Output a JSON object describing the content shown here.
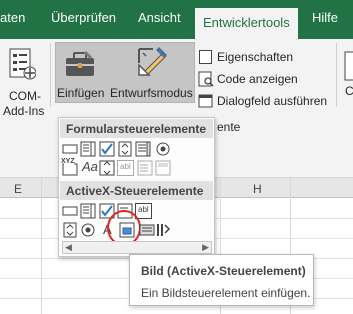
{
  "tabs": [
    {
      "label": "aten"
    },
    {
      "label": "Überprüfen"
    },
    {
      "label": "Ansicht"
    },
    {
      "label": "Entwicklertools"
    },
    {
      "label": "Hilfe"
    }
  ],
  "ribbon": {
    "com_addins": {
      "line1": "COM-",
      "line2": "Add-Ins"
    },
    "insert_label": "Einfügen",
    "design_mode_label": "Entwurfsmodus",
    "properties_label": "Eigenschaften",
    "view_code_label": "Code anzeigen",
    "run_dialog_label": "Dialogfeld ausführen",
    "group_label_partial": "ente",
    "right_partial_label": "C"
  },
  "dropdown": {
    "form_controls_header": "Formularsteuerelemente",
    "activex_header": "ActiveX-Steuerelemente",
    "aa_label": "Aa",
    "ab_label": "abl",
    "xyz_label": "XYZ",
    "a_label": "A"
  },
  "sheet": {
    "columns": [
      "E",
      "H"
    ]
  },
  "tooltip": {
    "title": "Bild (ActiveX-Steuerelement)",
    "description": "Ein Bildsteuerelement einfügen."
  },
  "colors": {
    "ribbon_green": "#217346",
    "ribbon_bg": "#f3f3f3",
    "selected_button": "#c5c5c5",
    "highlight_circle": "#e3261e",
    "checkbox_blue": "#2b78c9"
  }
}
